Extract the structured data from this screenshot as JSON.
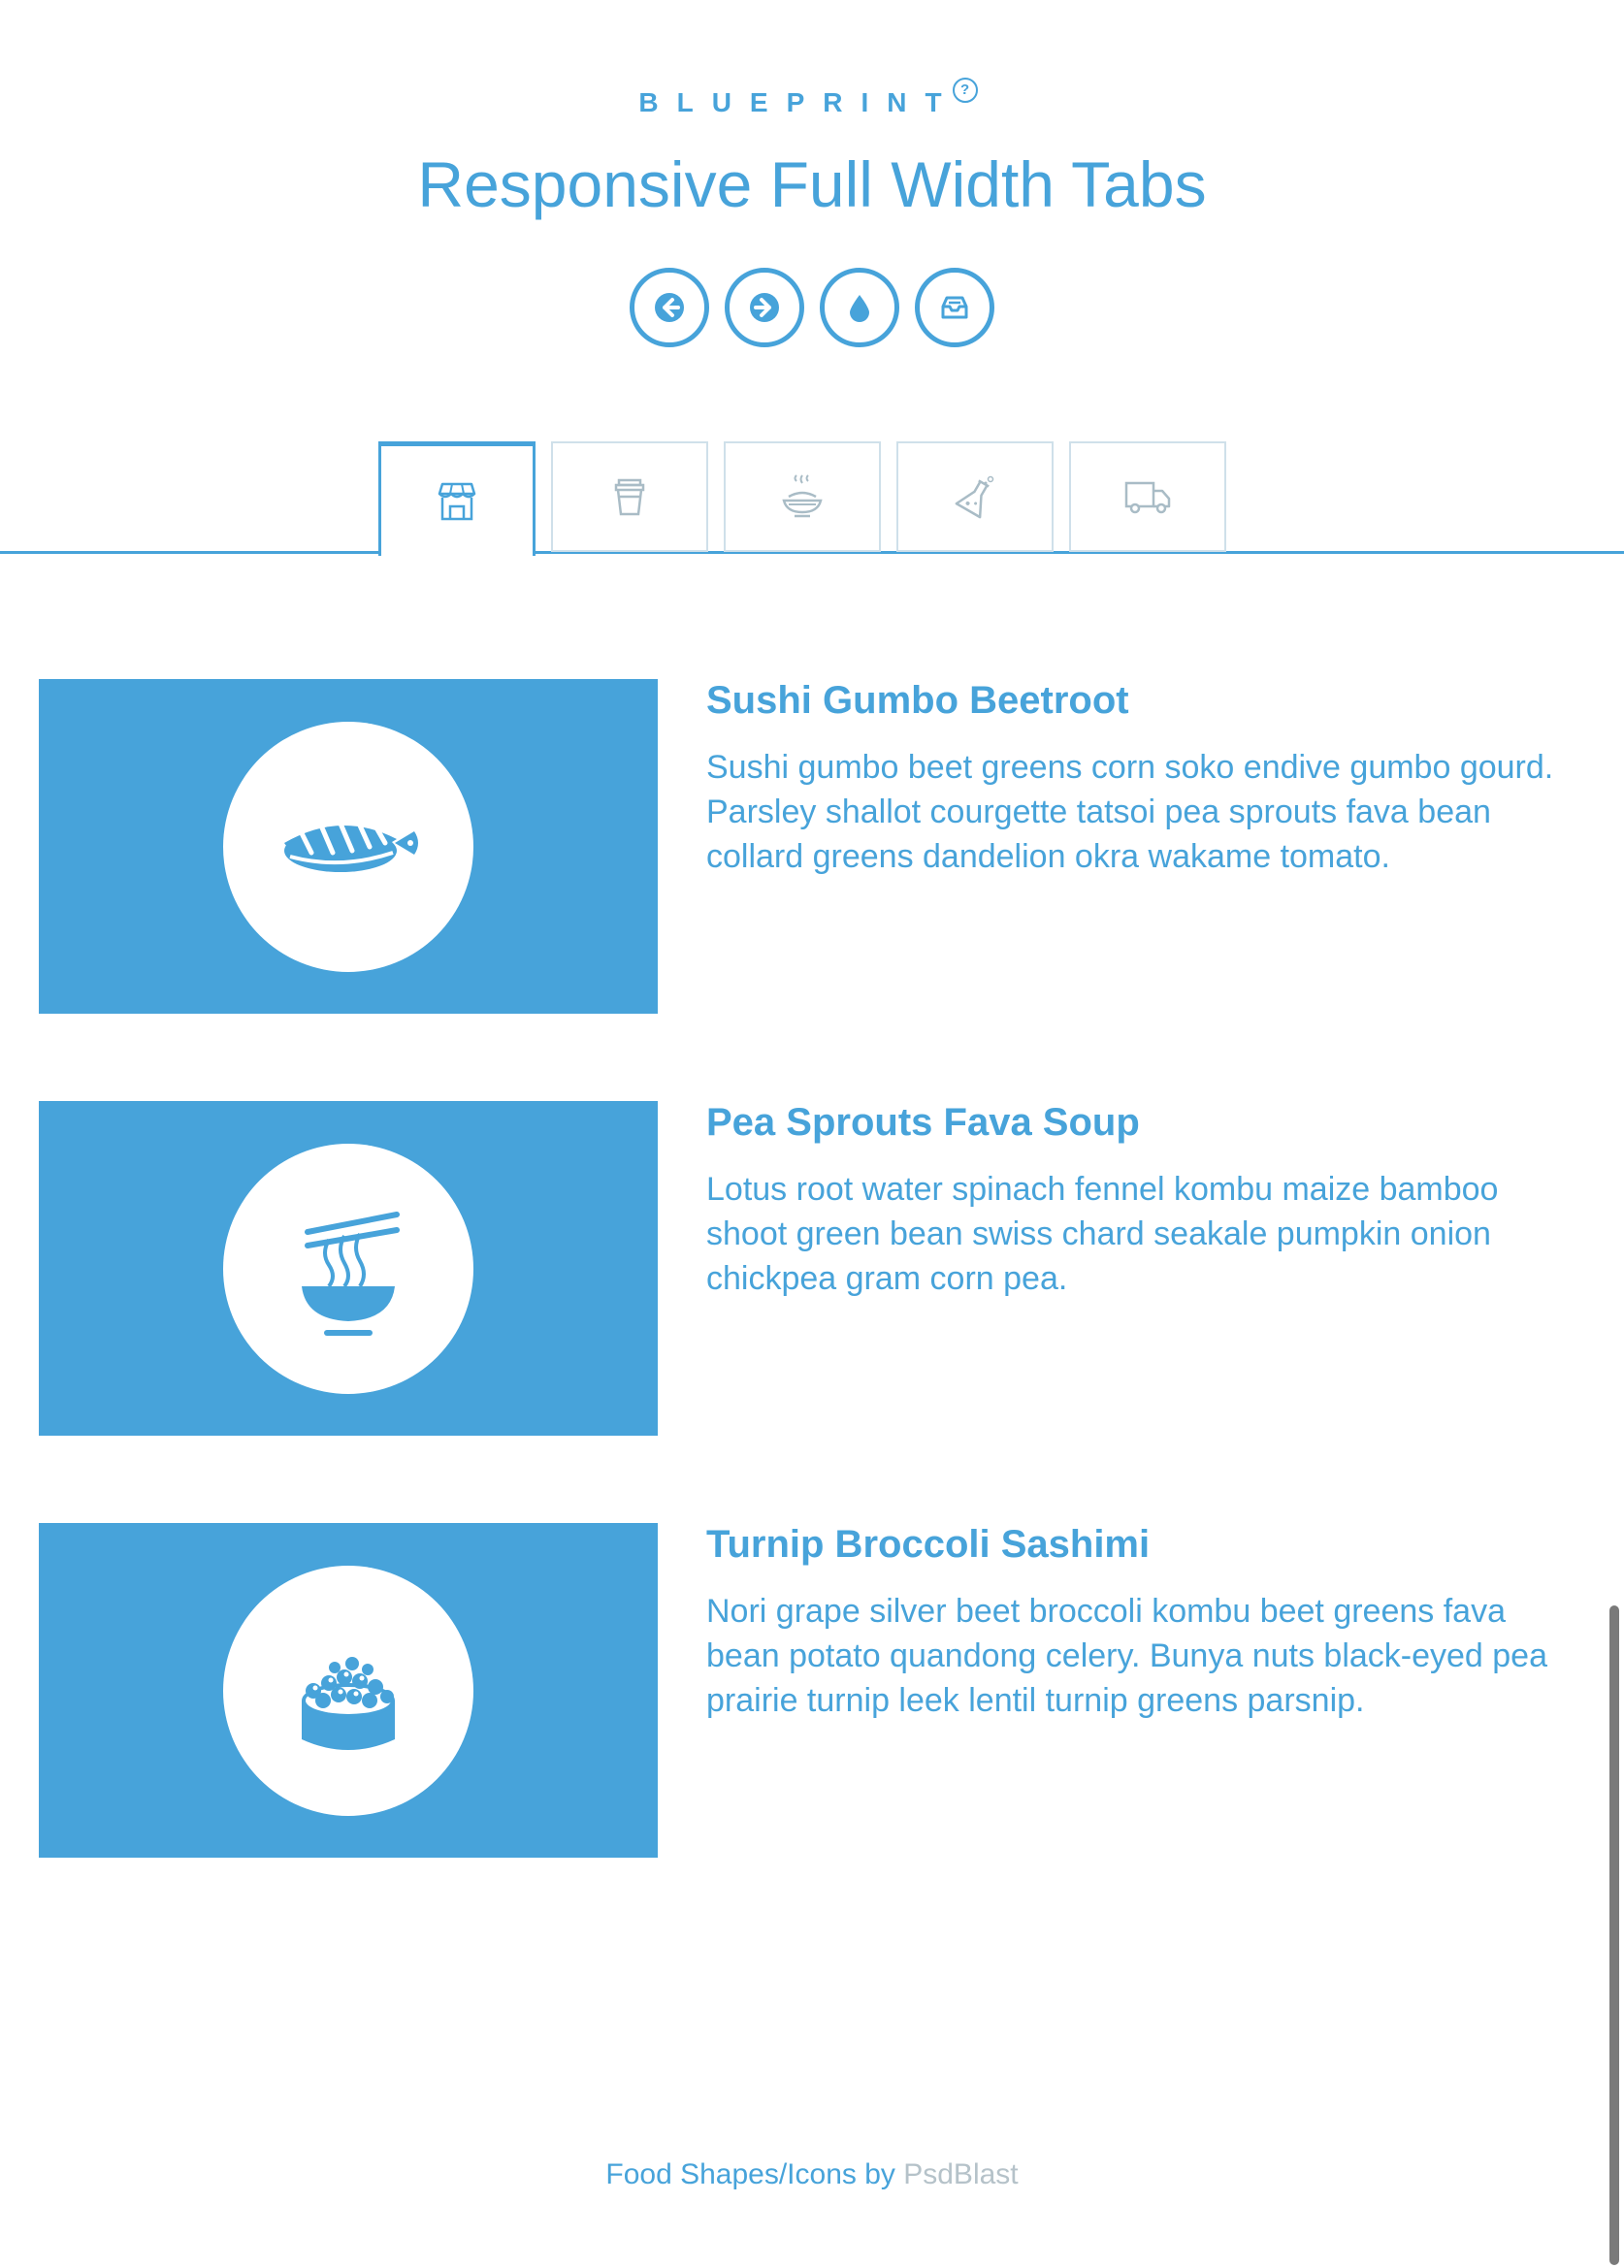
{
  "header": {
    "brand": "BLUEPRINT",
    "help_symbol": "?",
    "title": "Responsive Full Width Tabs",
    "nav_icons": [
      "arrow-left-icon",
      "arrow-right-icon",
      "drop-icon",
      "inbox-icon"
    ]
  },
  "tabs": [
    {
      "icon": "store-icon",
      "active": true
    },
    {
      "icon": "cup-icon",
      "active": false
    },
    {
      "icon": "food-bowl-icon",
      "active": false
    },
    {
      "icon": "lab-flask-icon",
      "active": false
    },
    {
      "icon": "truck-icon",
      "active": false
    }
  ],
  "items": [
    {
      "icon": "sushi-icon",
      "title": "Sushi Gumbo Beetroot",
      "text": "Sushi gumbo beet greens corn soko endive gumbo gourd. Parsley shallot courgette tatsoi pea sprouts fava bean collard greens dandelion okra wakame tomato."
    },
    {
      "icon": "noodle-bowl-icon",
      "title": "Pea Sprouts Fava Soup",
      "text": "Lotus root water spinach fennel kombu maize bamboo shoot green bean swiss chard seakale pumpkin onion chickpea gram corn pea."
    },
    {
      "icon": "roe-sushi-icon",
      "title": "Turnip Broccoli Sashimi",
      "text": "Nori grape silver beet broccoli kombu beet greens fava bean potato quandong celery. Bunya nuts black-eyed pea prairie turnip leek lentil turnip greens parsnip."
    }
  ],
  "footer": {
    "label": "Food Shapes/Icons by ",
    "link": "PsdBlast"
  },
  "colors": {
    "accent": "#47a3da",
    "tab_border": "#cfe0ea",
    "muted_link": "#b5c2c9"
  }
}
